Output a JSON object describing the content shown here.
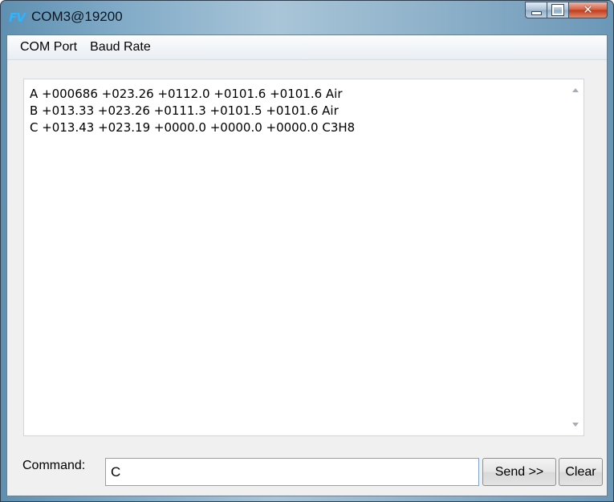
{
  "window": {
    "logo_text": "FV",
    "title": "COM3@19200"
  },
  "menu": {
    "items": [
      {
        "label": "COM Port"
      },
      {
        "label": "Baud Rate"
      }
    ]
  },
  "output": {
    "lines": [
      "A +000686 +023.26 +0112.0 +0101.6 +0101.6 Air",
      "B +013.33 +023.26 +0111.3 +0101.5 +0101.6 Air",
      "C +013.43 +023.19 +0000.0 +0000.0 +0000.0 C3H8"
    ]
  },
  "command": {
    "label": "Command:",
    "value": "C",
    "send_label": "Send >>",
    "clear_label": "Clear"
  },
  "colors": {
    "logo": "#2fb4ff",
    "input_border": "#7aa7d2",
    "close_button": "#c03a18"
  },
  "icons": {
    "minimize": "minimize-icon",
    "maximize": "maximize-icon",
    "close": "close-icon",
    "scroll_up": "scroll-up-arrow-icon",
    "scroll_down": "scroll-down-arrow-icon"
  }
}
